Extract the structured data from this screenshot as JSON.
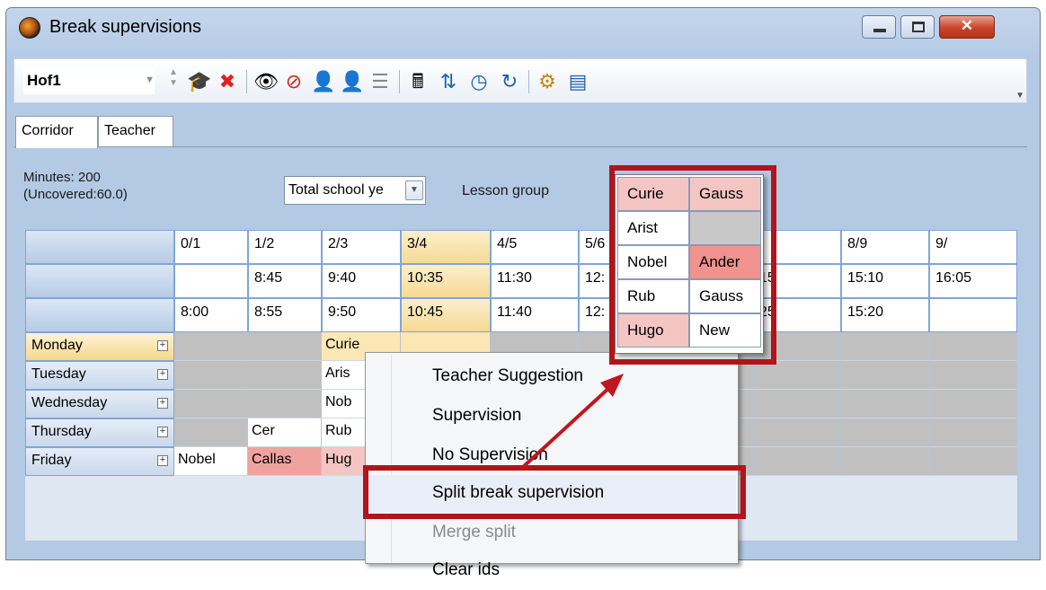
{
  "window": {
    "title": "Break supervisions",
    "controls": {
      "minimize": "–",
      "maximize": "□",
      "close": "✕"
    }
  },
  "toolbar": {
    "class_value": "Hof1",
    "icons": [
      "graduation-cap-icon",
      "delete-x-icon",
      "eye-icon",
      "eye-crossed-icon",
      "teacher-assign-icon",
      "teacher-remove-icon",
      "list-arrows-icon",
      "calculator-icon",
      "copy-sort-icon",
      "clock-icon",
      "refresh-icon",
      "settings-icon",
      "window-list-icon"
    ]
  },
  "tabs": [
    "Corridor",
    "Teacher"
  ],
  "info": {
    "minutes": "Minutes: 200",
    "uncovered": "(Uncovered:60.0)"
  },
  "period_combo": {
    "value": "Total school ye"
  },
  "lesson_group_label": "Lesson group",
  "grid": {
    "periods": [
      "0/1",
      "1/2",
      "2/3",
      "3/4",
      "4/5",
      "5/6",
      "",
      "",
      "8/9",
      "9/"
    ],
    "start_times": [
      "",
      "8:45",
      "9:40",
      "10:35",
      "11:30",
      "12:",
      "",
      "15",
      "15:10",
      "16:05"
    ],
    "end_times": [
      "8:00",
      "8:55",
      "9:50",
      "10:45",
      "11:40",
      "12:",
      "",
      "25",
      "15:20",
      ""
    ],
    "days": [
      {
        "name": "Monday",
        "cells": [
          "",
          "",
          "Curie",
          "",
          "",
          "",
          "",
          "",
          "",
          ""
        ]
      },
      {
        "name": "Tuesday",
        "cells": [
          "",
          "",
          "Aris",
          "",
          "",
          "",
          "",
          "",
          "",
          ""
        ]
      },
      {
        "name": "Wednesday",
        "cells": [
          "",
          "",
          "Nob",
          "",
          "",
          "",
          "",
          "",
          "",
          ""
        ]
      },
      {
        "name": "Thursday",
        "cells": [
          "",
          "Cer",
          "Rub",
          "",
          "",
          "",
          "",
          "",
          "",
          ""
        ]
      },
      {
        "name": "Friday",
        "cells": [
          "Nobel",
          "Callas",
          "Hug",
          "",
          "",
          "",
          "",
          "",
          "",
          ""
        ]
      }
    ]
  },
  "context_menu": {
    "items": [
      {
        "label": "Teacher Suggestion",
        "state": "normal"
      },
      {
        "label": "Supervision",
        "state": "normal"
      },
      {
        "label": "No Supervision",
        "state": "normal"
      },
      {
        "label": "Split break supervision",
        "state": "hover"
      },
      {
        "label": "Merge split",
        "state": "disabled"
      },
      {
        "label": "Clear ids",
        "state": "normal"
      }
    ]
  },
  "popup": {
    "rows": [
      [
        "Curie",
        "Gauss"
      ],
      [
        "Arist",
        ""
      ],
      [
        "Nobel",
        "Ander"
      ],
      [
        "Rub",
        "Gauss"
      ],
      [
        "Hugo",
        "New"
      ]
    ]
  },
  "colors": {
    "highlight": "#b3131b",
    "assigned_red": "#f0a29f",
    "unassigned_gray": "#c0c0c0",
    "current_yellow": "#fbe7b4"
  }
}
